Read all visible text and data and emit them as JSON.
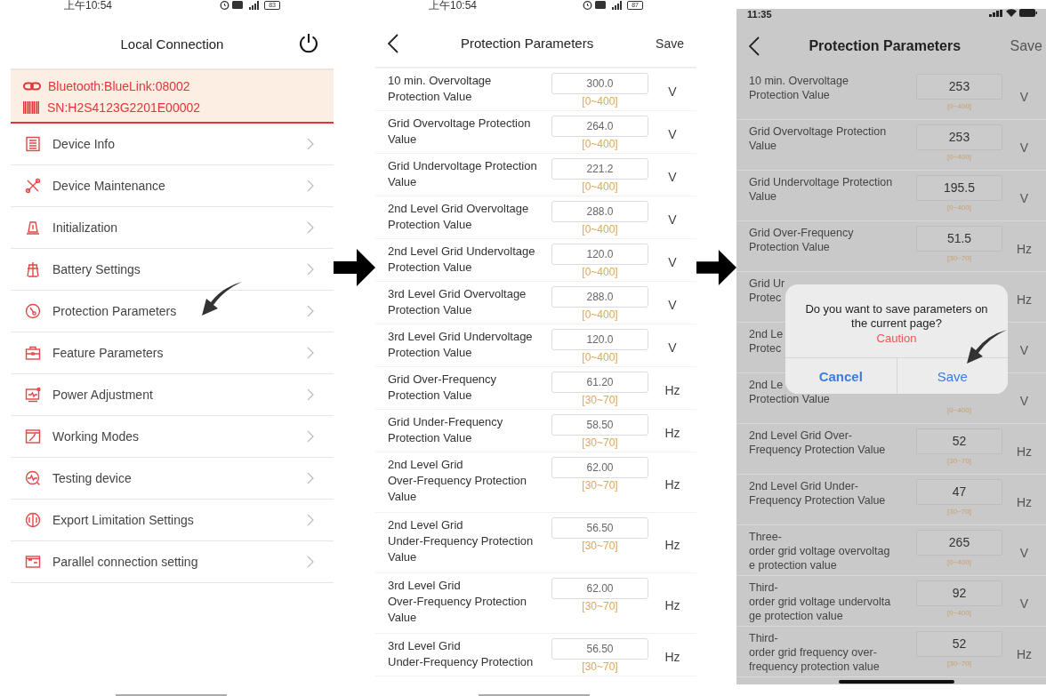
{
  "screens": [
    {
      "kind": "menu",
      "status_bar": {
        "time": "上午10:54",
        "battery": "83"
      },
      "title": "Local Connection",
      "connection": {
        "bluetooth": "Bluetooth:BlueLink:08002",
        "serial": "SN:H2S4123G2201E00002"
      },
      "items": [
        {
          "label": "Device Info"
        },
        {
          "label": "Device Maintenance"
        },
        {
          "label": "Initialization"
        },
        {
          "label": "Battery Settings"
        },
        {
          "label": "Protection Parameters"
        },
        {
          "label": "Feature Parameters"
        },
        {
          "label": "Power Adjustment"
        },
        {
          "label": "Working Modes"
        },
        {
          "label": "Testing device"
        },
        {
          "label": "Export Limitation Settings"
        },
        {
          "label": "Parallel connection setting"
        }
      ]
    },
    {
      "kind": "parameters",
      "dimmed": false,
      "status_bar": {
        "time": "上午10:54",
        "battery": "87"
      },
      "title": "Protection Parameters",
      "action": "Save",
      "rows": [
        {
          "label": "10 min. Overvoltage\nProtection Value",
          "value": "300.0",
          "range": "[0~400]",
          "unit": "V"
        },
        {
          "label": "Grid Overvoltage Protection\nValue",
          "value": "264.0",
          "range": "[0~400]",
          "unit": "V"
        },
        {
          "label": "Grid Undervoltage Protection\nValue",
          "value": "221.2",
          "range": "[0~400]",
          "unit": "V"
        },
        {
          "label": "2nd Level Grid Overvoltage\nProtection Value",
          "value": "288.0",
          "range": "[0~400]",
          "unit": "V"
        },
        {
          "label": "2nd Level Grid Undervoltage\nProtection Value",
          "value": "120.0",
          "range": "[0~400]",
          "unit": "V"
        },
        {
          "label": "3rd Level Grid Overvoltage\nProtection Value",
          "value": "288.0",
          "range": "[0~400]",
          "unit": "V"
        },
        {
          "label": "3rd Level Grid Undervoltage\nProtection Value",
          "value": "120.0",
          "range": "[0~400]",
          "unit": "V"
        },
        {
          "label": "Grid Over-Frequency\nProtection Value",
          "value": "61.20",
          "range": "[30~70]",
          "unit": "Hz"
        },
        {
          "label": "Grid Under-Frequency\nProtection Value",
          "value": "58.50",
          "range": "[30~70]",
          "unit": "Hz"
        },
        {
          "label": "2nd Level Grid\nOver-Frequency Protection\nValue",
          "value": "62.00",
          "range": "[30~70]",
          "unit": "Hz"
        },
        {
          "label": "2nd Level Grid\nUnder-Frequency Protection\nValue",
          "value": "56.50",
          "range": "[30~70]",
          "unit": "Hz"
        },
        {
          "label": "3rd Level Grid\nOver-Frequency Protection\nValue",
          "value": "62.00",
          "range": "[30~70]",
          "unit": "Hz"
        },
        {
          "label": "3rd Level Grid\nUnder-Frequency Protection",
          "value": "56.50",
          "range": "[30~70]",
          "unit": "Hz"
        }
      ]
    },
    {
      "kind": "parameters",
      "dimmed": true,
      "status_bar": {
        "time": "11:35"
      },
      "title": "Protection Parameters",
      "action": "Save",
      "rows": [
        {
          "label": "10 min. Overvoltage\nProtection Value",
          "value": "253",
          "range": "[0~400]",
          "unit": "V"
        },
        {
          "label": "Grid Overvoltage Protection\nValue",
          "value": "253",
          "range": "[0~400]",
          "unit": "V"
        },
        {
          "label": "Grid Undervoltage Protection\nValue",
          "value": "195.5",
          "range": "[0~400]",
          "unit": "V"
        },
        {
          "label": "Grid Over-Frequency\nProtection Value",
          "value": "51.5",
          "range": "[30~70]",
          "unit": "Hz"
        },
        {
          "label": "Grid Ur\nProtec",
          "unit": "Hz"
        },
        {
          "label": "2nd Le\nProtec",
          "unit": "V"
        },
        {
          "label": "2nd Le\nProtection Value",
          "range": "[0~400]",
          "unit": "V"
        },
        {
          "label": "2nd Level Grid Over-\nFrequency Protection Value",
          "value": "52",
          "range": "[30~70]",
          "unit": "Hz"
        },
        {
          "label": "2nd Level Grid Under-\nFrequency Protection Value",
          "value": "47",
          "range": "[30~70]",
          "unit": "Hz"
        },
        {
          "label": "Three-\norder grid voltage overvoltag\ne protection value",
          "value": "265",
          "range": "[0~400]",
          "unit": "V"
        },
        {
          "label": "Third-\norder grid voltage undervolta\nge protection value",
          "value": "92",
          "range": "[0~400]",
          "unit": "V"
        },
        {
          "label": "Third-\norder grid frequency over-\nfrequency protection value",
          "value": "52",
          "range": "[30~70]",
          "unit": "Hz"
        }
      ],
      "dialog": {
        "message": "Do you want to save parameters on the current page?",
        "warning": "Caution",
        "buttons": [
          {
            "label": "Cancel",
            "kind": "cancel"
          },
          {
            "label": "Save",
            "kind": "confirm"
          }
        ]
      }
    }
  ]
}
